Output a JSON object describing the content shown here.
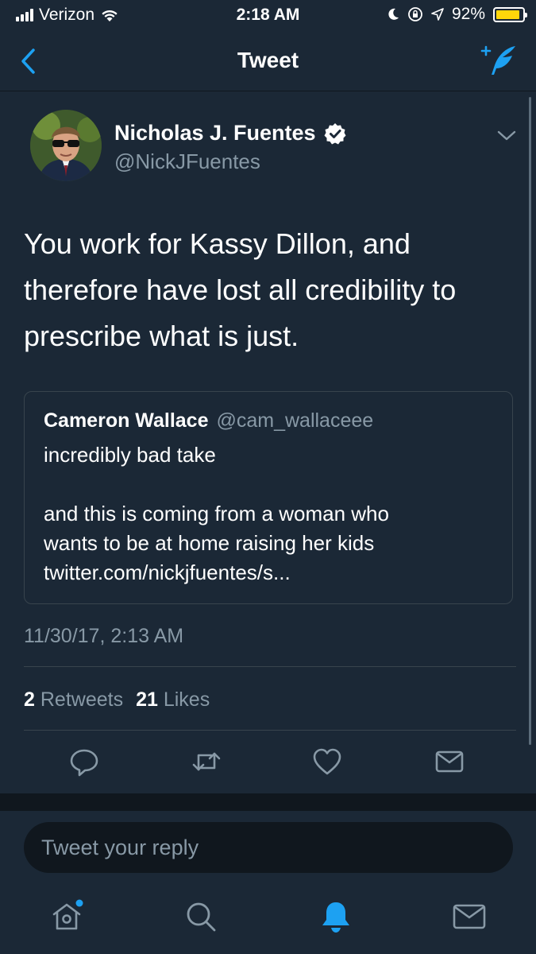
{
  "status_bar": {
    "carrier": "Verizon",
    "time": "2:18 AM",
    "battery_percent": "92%",
    "battery_level": 0.92,
    "battery_color": "#ffd60a"
  },
  "nav": {
    "title": "Tweet",
    "back_icon": "chevron-left-icon",
    "compose_icon": "compose-tweet-icon"
  },
  "tweet": {
    "author_name": "Nicholas J. Fuentes",
    "author_handle": "@NickJFuentes",
    "verified": true,
    "text": "You work for Kassy Dillon, and therefore have lost all credibility to prescribe what is just.",
    "quoted": {
      "name": "Cameron Wallace",
      "handle": "@cam_wallaceee",
      "line1": "incredibly bad take",
      "line2": "and this is coming from a woman who",
      "line3": "wants to be at home raising her kids",
      "link": "twitter.com/nickjfuentes/s..."
    },
    "timestamp": "11/30/17, 2:13 AM",
    "retweets_count": "2",
    "retweets_label": "Retweets",
    "likes_count": "21",
    "likes_label": "Likes"
  },
  "actions": [
    "reply-icon",
    "retweet-icon",
    "like-icon",
    "direct-message-icon"
  ],
  "reply": {
    "placeholder": "Tweet your reply"
  },
  "tab_bar": [
    "home-icon",
    "search-icon",
    "notifications-icon",
    "messages-icon"
  ],
  "colors": {
    "background": "#1b2836",
    "accent": "#1da1f2",
    "secondary_text": "#8899a6"
  }
}
